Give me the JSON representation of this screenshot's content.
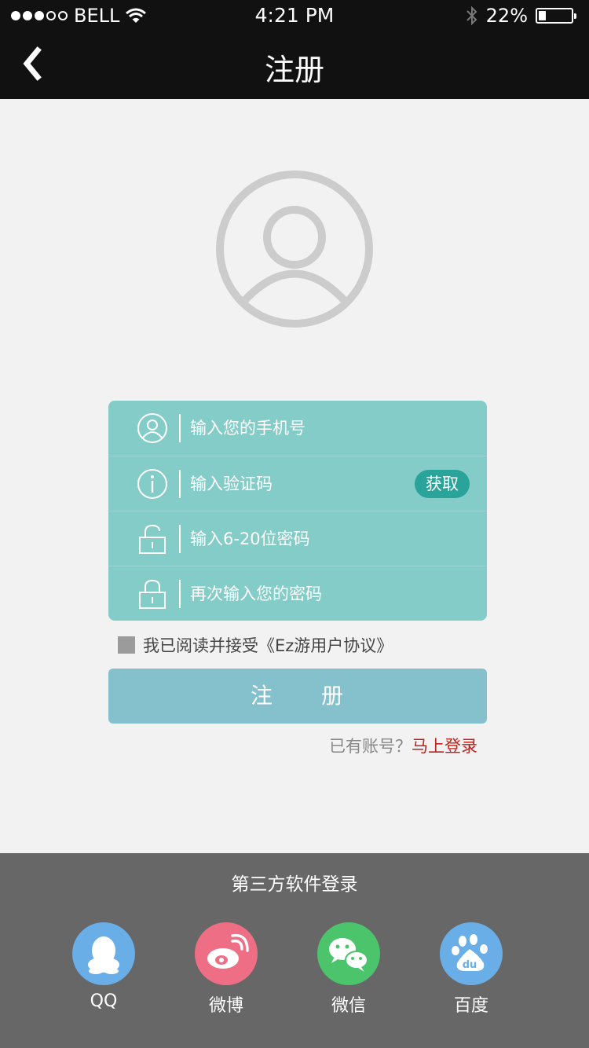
{
  "status_bar": {
    "carrier": "BELL",
    "time": "4:21 PM",
    "battery_percent": "22%",
    "battery_level": 0.22,
    "signal_dots_filled": 3,
    "signal_dots_total": 5,
    "icons": [
      "wifi-icon",
      "bluetooth-icon",
      "battery-icon"
    ]
  },
  "nav": {
    "back_icon": "chevron-left-icon",
    "title": "注册"
  },
  "avatar": {
    "icon": "user-avatar-icon"
  },
  "form": {
    "phone": {
      "icon": "user-icon",
      "placeholder": "输入您的手机号",
      "value": ""
    },
    "code": {
      "icon": "info-icon",
      "placeholder": "输入验证码",
      "value": "",
      "button_label": "获取"
    },
    "password": {
      "icon": "unlock-icon",
      "placeholder": "输入6-20位密码",
      "value": ""
    },
    "confirm": {
      "icon": "lock-icon",
      "placeholder": "再次输入您的密码",
      "value": ""
    }
  },
  "agreement": {
    "checked": false,
    "text": "我已阅读并接受《Ez游用户协议》"
  },
  "register_button": {
    "label": "注　　册"
  },
  "login": {
    "question": "已有账号？",
    "link": "马上登录"
  },
  "third_party": {
    "title": "第三方软件登录",
    "items": [
      {
        "label": "QQ",
        "icon": "qq-icon",
        "color": "#6aaee8"
      },
      {
        "label": "微博",
        "icon": "weibo-icon",
        "color": "#ee6f85"
      },
      {
        "label": "微信",
        "icon": "wechat-icon",
        "color": "#4cc46c"
      },
      {
        "label": "百度",
        "icon": "baidu-icon",
        "color": "#6aaee8"
      }
    ]
  },
  "colors": {
    "form_bg": "#84ccc8",
    "accent_button": "#2aa39a",
    "register_button": "#84c1cc",
    "login_link": "#c0211b",
    "bottom_panel": "#676767"
  }
}
